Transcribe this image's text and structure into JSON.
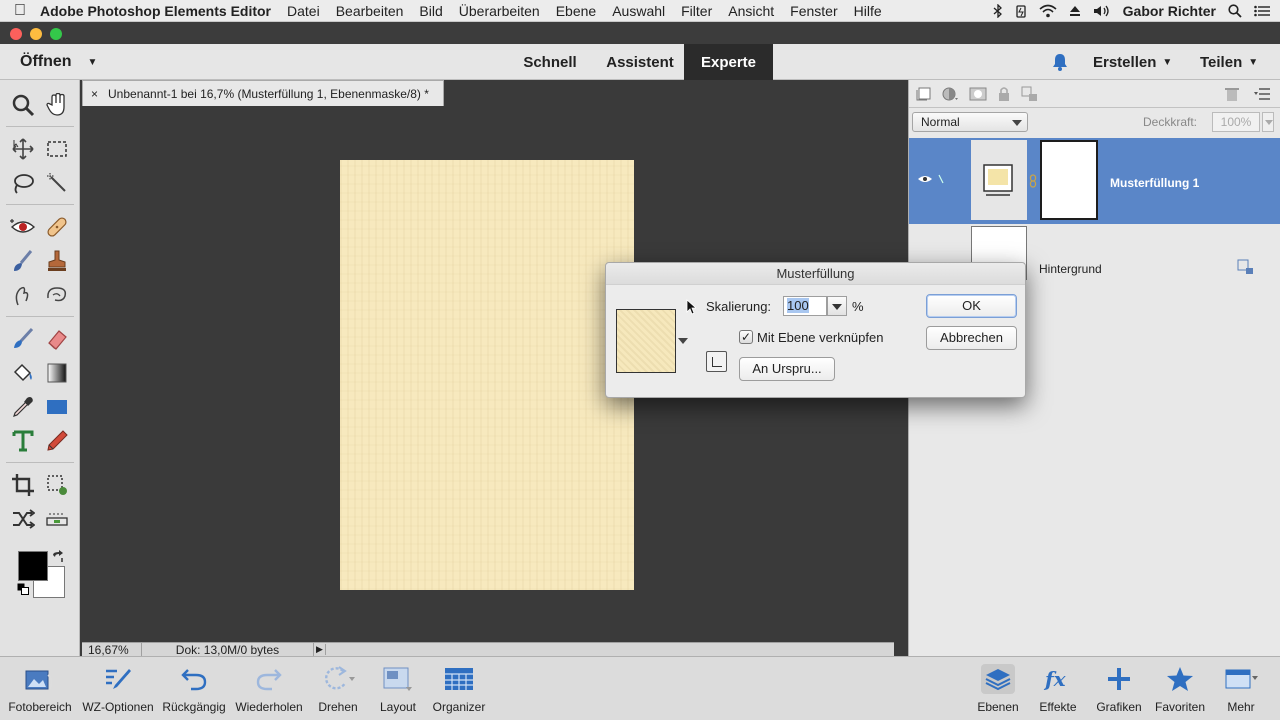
{
  "menubar": {
    "app_name": "Adobe Photoshop Elements Editor",
    "items": [
      "Datei",
      "Bearbeiten",
      "Bild",
      "Überarbeiten",
      "Ebene",
      "Auswahl",
      "Filter",
      "Ansicht",
      "Fenster",
      "Hilfe"
    ],
    "user": "Gabor Richter"
  },
  "topbar": {
    "open_label": "Öffnen",
    "modes": [
      "Schnell",
      "Assistent",
      "Experte"
    ],
    "active_mode": "Experte",
    "create_label": "Erstellen",
    "share_label": "Teilen"
  },
  "document": {
    "tab_close": "×",
    "tab_title": "Unbenannt-1 bei 16,7% (Musterfüllung 1, Ebenenmaske/8) *",
    "paper_color": "#f7e9be"
  },
  "status": {
    "zoom": "16,67%",
    "doc_info": "Dok: 13,0M/0 bytes",
    "arrow": "▶"
  },
  "layers_panel": {
    "blend_mode": "Normal",
    "opacity_label": "Deckkraft:",
    "opacity_value": "100%",
    "layers": [
      {
        "name": "Musterfüllung 1",
        "selected": true
      },
      {
        "name": "Hintergrund",
        "selected": false
      }
    ],
    "selection_color": "#5a86c8"
  },
  "dialog": {
    "title": "Musterfüllung",
    "scale_label": "Skalierung:",
    "scale_value": "100",
    "scale_unit": "%",
    "link_label": "Mit Ebene verknüpfen",
    "link_checked": true,
    "check_mark": "✓",
    "snap_button": "An Urspru...",
    "ok_label": "OK",
    "cancel_label": "Abbrechen"
  },
  "bottombar": {
    "items": [
      {
        "label": "Fotobereich",
        "icon": "photo-bin-icon"
      },
      {
        "label": "WZ-Optionen",
        "icon": "tool-options-icon"
      },
      {
        "label": "Rückgängig",
        "icon": "undo-icon"
      },
      {
        "label": "Wiederholen",
        "icon": "redo-icon"
      },
      {
        "label": "Drehen",
        "icon": "rotate-icon"
      },
      {
        "label": "Layout",
        "icon": "layout-icon"
      },
      {
        "label": "Organizer",
        "icon": "organizer-icon"
      },
      {
        "label": "Ebenen",
        "icon": "layers-icon"
      },
      {
        "label": "Effekte",
        "icon": "fx-icon"
      },
      {
        "label": "Grafiken",
        "icon": "plus-icon"
      },
      {
        "label": "Favoriten",
        "icon": "star-icon"
      },
      {
        "label": "Mehr",
        "icon": "more-icon"
      }
    ],
    "accent_color": "#2f6fc1"
  }
}
